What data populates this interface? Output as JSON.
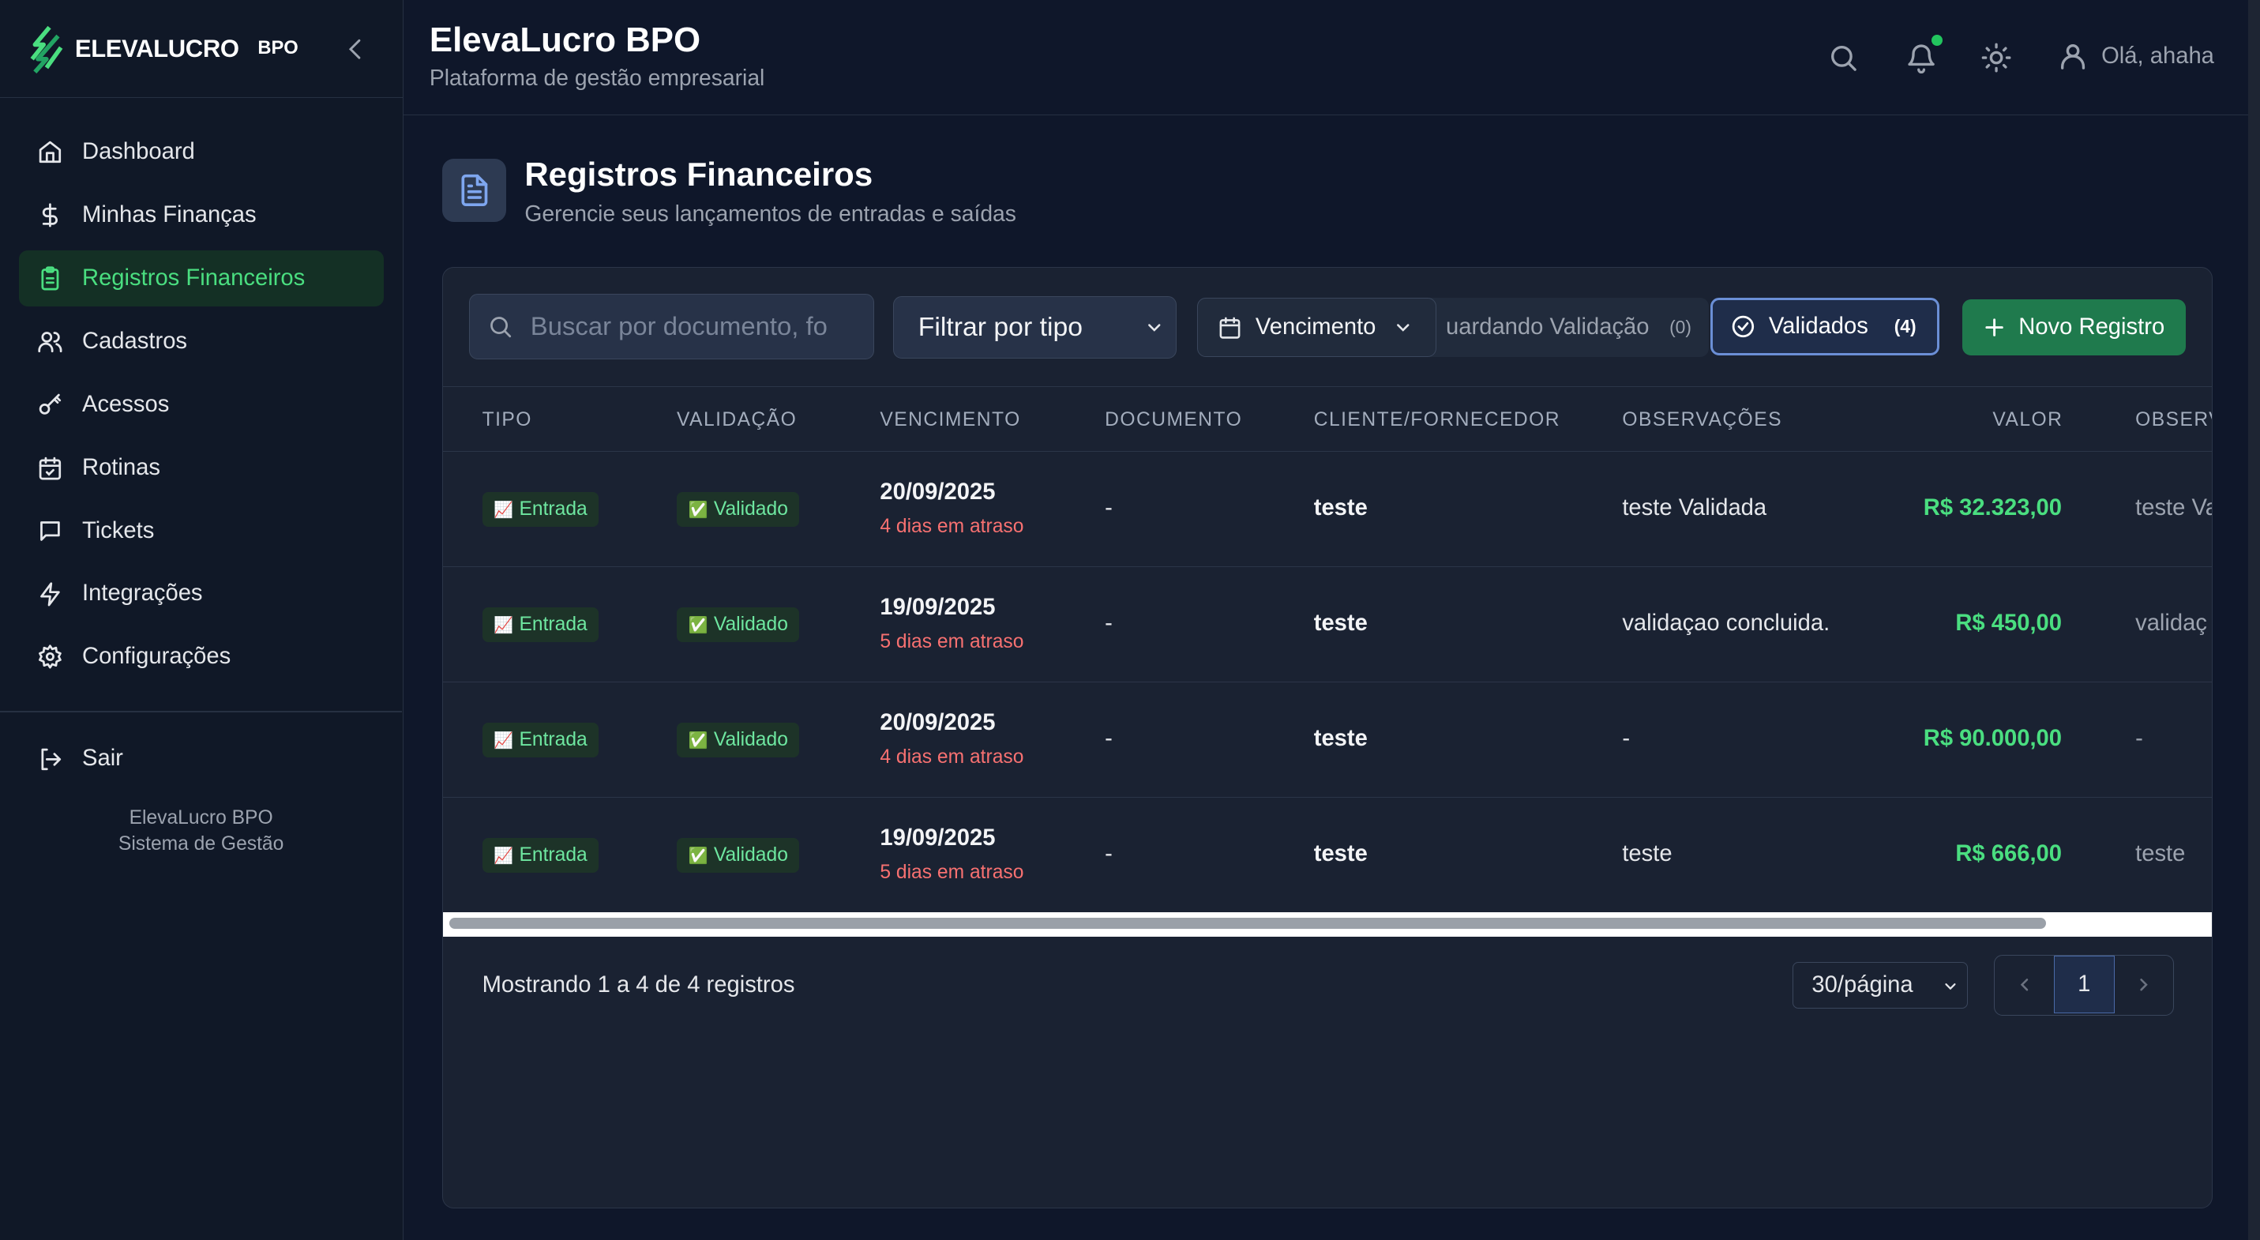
{
  "brand": {
    "name": "ELEVALUCRO",
    "tag": "BPO"
  },
  "sidebar": {
    "items": [
      {
        "label": "Dashboard",
        "icon": "home-icon"
      },
      {
        "label": "Minhas Finanças",
        "icon": "dollar-icon"
      },
      {
        "label": "Registros Financeiros",
        "icon": "clipboard-icon",
        "active": true
      },
      {
        "label": "Cadastros",
        "icon": "users-icon"
      },
      {
        "label": "Acessos",
        "icon": "key-icon"
      },
      {
        "label": "Rotinas",
        "icon": "calendar-check-icon"
      },
      {
        "label": "Tickets",
        "icon": "message-icon"
      },
      {
        "label": "Integrações",
        "icon": "zap-icon"
      },
      {
        "label": "Configurações",
        "icon": "gear-icon"
      }
    ],
    "logout": "Sair",
    "footer_line1": "ElevaLucro BPO",
    "footer_line2": "Sistema de Gestão"
  },
  "header": {
    "title": "ElevaLucro BPO",
    "subtitle": "Plataforma de gestão empresarial",
    "user_greeting": "Olá, ahaha"
  },
  "page": {
    "title": "Registros Financeiros",
    "subtitle": "Gerencie seus lançamentos de entradas e saídas"
  },
  "toolbar": {
    "search_placeholder": "Buscar por documento, fo",
    "filter_type": "Filtrar por tipo",
    "due_filter": "Vencimento",
    "awaiting_label": "uardando Validação",
    "awaiting_count": "(0)",
    "validated_label": "Validados",
    "validated_count": "(4)",
    "new_label": "Novo Registro"
  },
  "table": {
    "columns": [
      "TIPO",
      "VALIDAÇÃO",
      "VENCIMENTO",
      "DOCUMENTO",
      "CLIENTE/FORNECEDOR",
      "OBSERVAÇÕES",
      "VALOR",
      "OBSERV"
    ],
    "rows": [
      {
        "tipo": "Entrada",
        "validacao": "Validado",
        "vencimento": "20/09/2025",
        "atraso": "4 dias em atraso",
        "documento": "-",
        "cliente": "teste",
        "observacoes": "teste Validada",
        "valor": "R$ 32.323,00",
        "observ": "teste Va"
      },
      {
        "tipo": "Entrada",
        "validacao": "Validado",
        "vencimento": "19/09/2025",
        "atraso": "5 dias em atraso",
        "documento": "-",
        "cliente": "teste",
        "observacoes": "validaçao concluida.",
        "valor": "R$ 450,00",
        "observ": "validaç"
      },
      {
        "tipo": "Entrada",
        "validacao": "Validado",
        "vencimento": "20/09/2025",
        "atraso": "4 dias em atraso",
        "documento": "-",
        "cliente": "teste",
        "observacoes": "-",
        "valor": "R$ 90.000,00",
        "observ": "-"
      },
      {
        "tipo": "Entrada",
        "validacao": "Validado",
        "vencimento": "19/09/2025",
        "atraso": "5 dias em atraso",
        "documento": "-",
        "cliente": "teste",
        "observacoes": "teste",
        "valor": "R$ 666,00",
        "observ": "teste"
      }
    ]
  },
  "footer": {
    "showing": "Mostrando 1 a 4 de 4 registros",
    "per_page": "30/página",
    "current_page": "1"
  },
  "colors": {
    "accent_green": "#4ade80",
    "danger_red": "#f87171",
    "primary_button": "#1f7a4d",
    "background": "#0f172a"
  }
}
